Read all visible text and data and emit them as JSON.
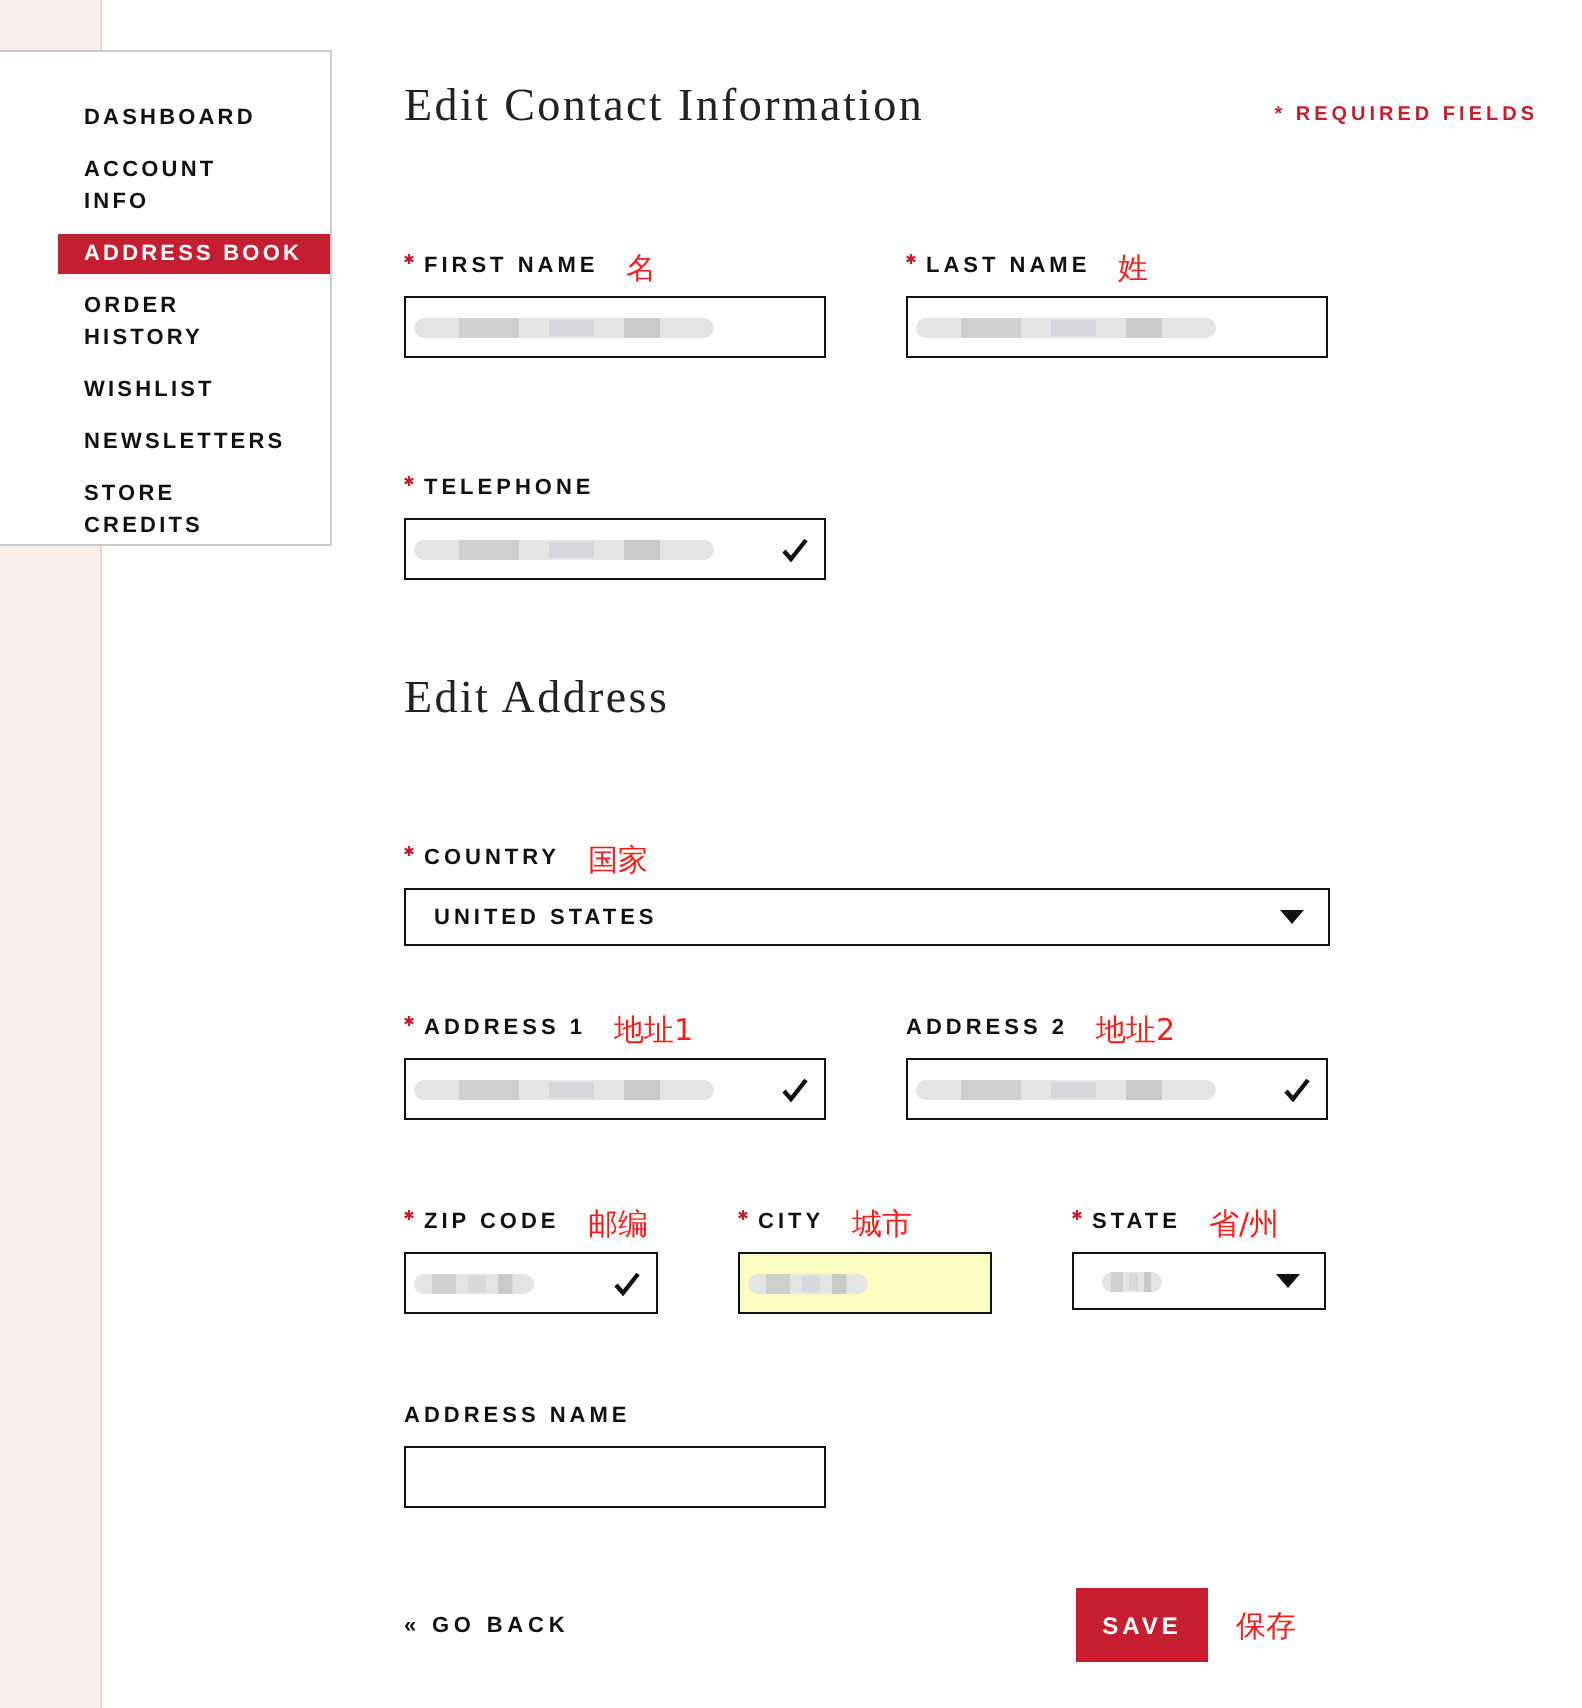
{
  "sidebar": {
    "items": [
      {
        "label": "DASHBOARD",
        "selected": false
      },
      {
        "label": "ACCOUNT INFO",
        "selected": false
      },
      {
        "label": "ADDRESS BOOK",
        "selected": true
      },
      {
        "label": "ORDER HISTORY",
        "selected": false
      },
      {
        "label": "WISHLIST",
        "selected": false
      },
      {
        "label": "NEWSLETTERS",
        "selected": false
      },
      {
        "label": "STORE CREDITS",
        "selected": false
      }
    ]
  },
  "sections": [
    {
      "title": "Edit Contact Information",
      "note": "* REQUIRED FIELDS",
      "rows": [
        [
          {
            "label": "FIRST NAME",
            "required": true,
            "annotation": "名",
            "kind": "text",
            "filled": true,
            "valid": false,
            "autofilled": false
          },
          {
            "label": "LAST NAME",
            "required": true,
            "annotation": "姓",
            "kind": "text",
            "filled": true,
            "valid": false,
            "autofilled": false
          }
        ],
        [
          {
            "label": "TELEPHONE",
            "required": true,
            "kind": "text",
            "filled": true,
            "valid": true,
            "autofilled": false
          }
        ]
      ]
    },
    {
      "title": "Edit Address",
      "rows": [
        [
          {
            "label": "COUNTRY",
            "required": true,
            "annotation": "国家",
            "kind": "select",
            "value": "UNITED STATES"
          }
        ],
        [
          {
            "label": "ADDRESS 1",
            "required": true,
            "annotation": "地址1",
            "kind": "text",
            "filled": true,
            "valid": true,
            "autofilled": false
          },
          {
            "label": "ADDRESS 2",
            "required": false,
            "annotation": "地址2",
            "kind": "text",
            "filled": true,
            "valid": true,
            "autofilled": false
          }
        ],
        [
          {
            "label": "ZIP CODE",
            "required": true,
            "annotation": "邮编",
            "kind": "text",
            "filled": true,
            "valid": true,
            "autofilled": false
          },
          {
            "label": "CITY",
            "required": true,
            "annotation": "城市",
            "kind": "text",
            "filled": true,
            "valid": false,
            "autofilled": true
          },
          {
            "label": "STATE",
            "required": true,
            "annotation": "省/州",
            "kind": "select",
            "filled": true
          }
        ],
        [
          {
            "label": "ADDRESS NAME",
            "required": false,
            "kind": "text",
            "filled": false,
            "valid": false,
            "autofilled": false
          }
        ]
      ]
    }
  ],
  "footer": {
    "back": "« GO BACK",
    "save": "SAVE",
    "save_annotation": "保存"
  }
}
